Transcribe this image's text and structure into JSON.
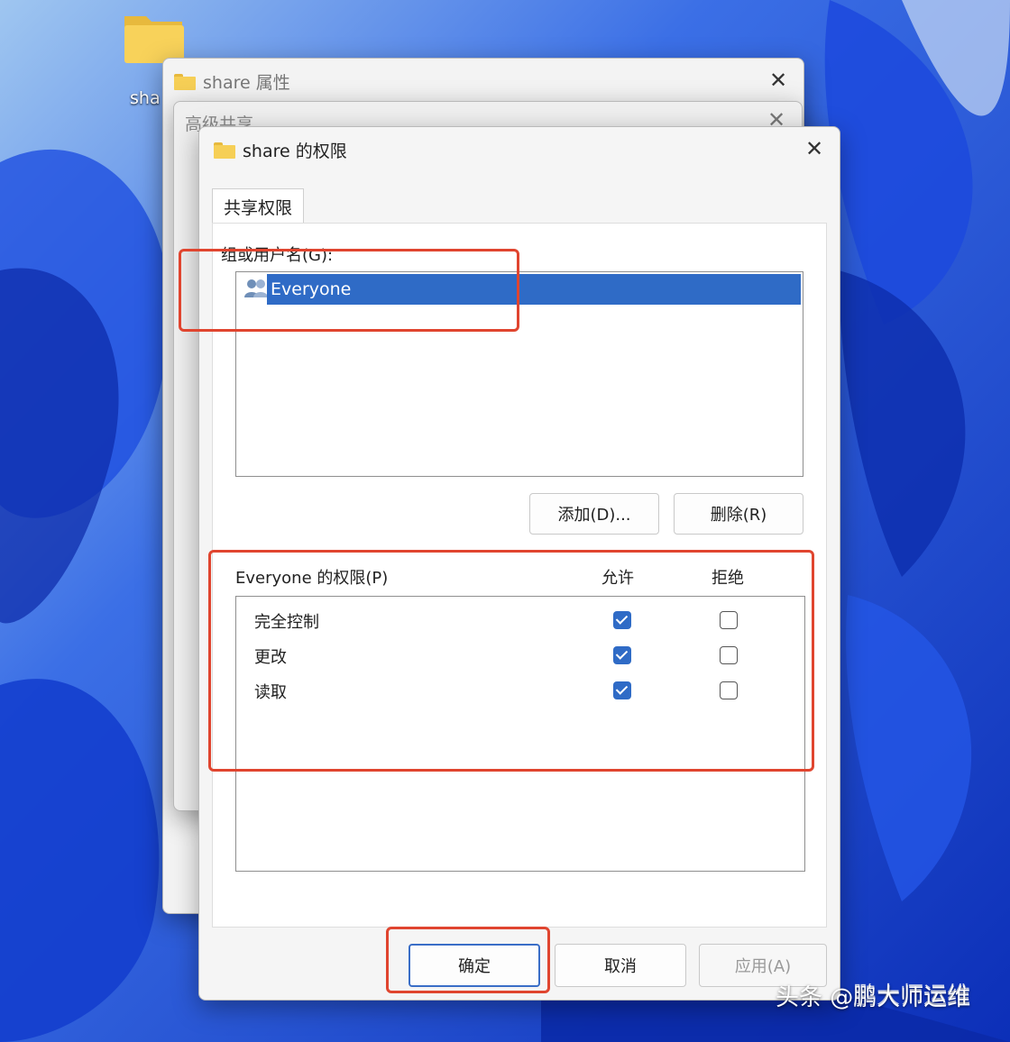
{
  "desktop": {
    "icon_label": "sha"
  },
  "window_properties": {
    "title": "share 属性"
  },
  "window_advanced": {
    "title": "高级共享"
  },
  "dialog": {
    "title": "share 的权限",
    "tab": "共享权限",
    "group_label": "组或用户名(G):",
    "users": [
      "Everyone"
    ],
    "add_button": "添加(D)...",
    "remove_button": "删除(R)",
    "permissions_header": "Everyone 的权限(P)",
    "allow_header": "允许",
    "deny_header": "拒绝",
    "permissions": [
      {
        "label": "完全控制",
        "allow": true,
        "deny": false
      },
      {
        "label": "更改",
        "allow": true,
        "deny": false
      },
      {
        "label": "读取",
        "allow": true,
        "deny": false
      }
    ],
    "ok_button": "确定",
    "cancel_button": "取消",
    "apply_button": "应用(A)"
  },
  "watermark": {
    "text": "头条 @鹏大师运维",
    "partial": "鹏大师运维"
  },
  "colors": {
    "selection": "#2f6bc6",
    "highlight": "#e0452f",
    "wallpaper": "#1a3fd6"
  }
}
